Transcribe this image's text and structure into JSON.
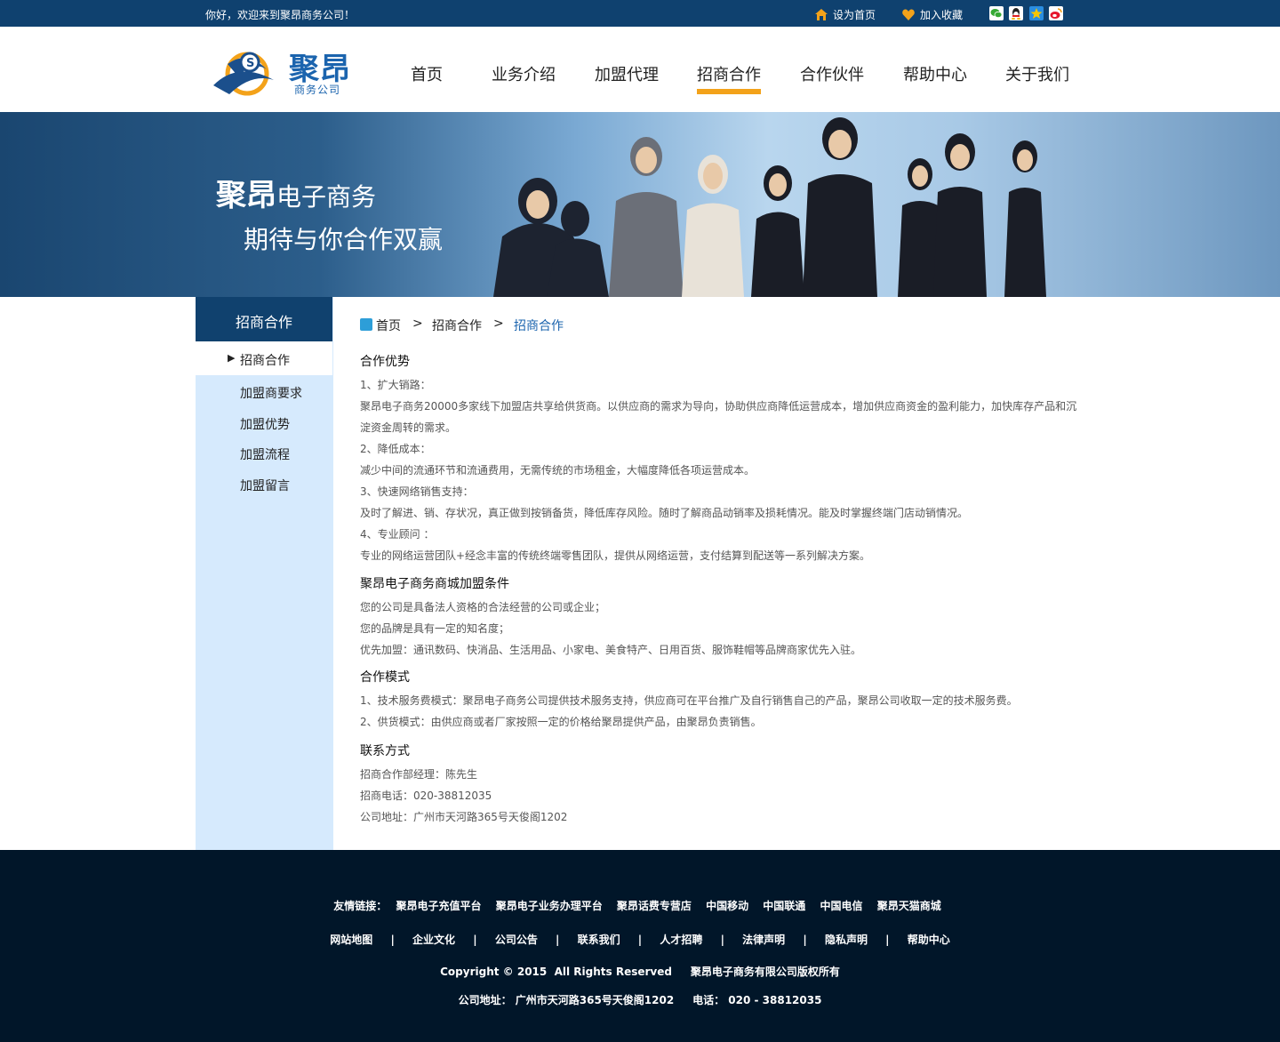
{
  "topbar": {
    "welcome": "你好，欢迎来到聚昂商务公司！",
    "set_home": "设为首页",
    "bookmark": "加入收藏",
    "social_icons": [
      "wechat-icon",
      "qq-icon",
      "qzone-icon",
      "weibo-icon"
    ]
  },
  "logo": {
    "name": "聚昂",
    "sub": "商务公司"
  },
  "nav": {
    "items": [
      "首页",
      "业务介绍",
      "加盟代理",
      "招商合作",
      "合作伙伴",
      "帮助中心",
      "关于我们"
    ],
    "active": "招商合作"
  },
  "banner": {
    "line1_bold": "聚昂",
    "line1_rest": "电子商务",
    "line2": "期待与你合作双赢"
  },
  "sidebar": {
    "title": "招商合作",
    "active_item": "招商合作",
    "items": [
      "加盟商要求",
      "加盟优势",
      "加盟流程",
      "加盟留言"
    ]
  },
  "breadcrumb": {
    "home": "首页",
    "sep": ">",
    "level1": "招商合作",
    "level2": "招商合作"
  },
  "content": {
    "s1_title": "合作优势",
    "s1_l1": "1、扩大销路：",
    "s1_l2": "聚昂电子商务20000多家线下加盟店共享给供货商。以供应商的需求为导向，协助供应商降低运营成本，增加供应商资金的盈利能力，加快库存产品和沉",
    "s1_l3": "淀资金周转的需求。",
    "s1_l4": "2、降低成本：",
    "s1_l5": "减少中间的流通环节和流通费用，无需传统的市场租金，大幅度降低各项运营成本。",
    "s1_l6": "3、快速网络销售支持：",
    "s1_l7": "及时了解进、销、存状况，真正做到按销备货，降低库存风险。随时了解商品动销率及损耗情况。能及时掌握终端门店动销情况。",
    "s1_l8": "4、专业顾问 ：",
    "s1_l9": "专业的网络运营团队+经念丰富的传统终端零售团队，提供从网络运营，支付结算到配送等一系列解决方案。",
    "s2_title": "聚昂电子商务商城加盟条件",
    "s2_l1": "您的公司是具备法人资格的合法经营的公司或企业；",
    "s2_l2": "您的品牌是具有一定的知名度；",
    "s2_l3": "优先加盟：通讯数码、快消品、生活用品、小家电、美食特产、日用百货、服饰鞋帽等品牌商家优先入驻。",
    "s3_title": "合作模式",
    "s3_l1": "1、技术服务费模式：聚昂电子商务公司提供技术服务支持，供应商可在平台推广及自行销售自己的产品，聚昂公司收取一定的技术服务费。",
    "s3_l2": "2、供货模式：由供应商或者厂家按照一定的价格给聚昂提供产品，由聚昂负责销售。",
    "s4_title": "联系方式",
    "s4_l1": "招商合作部经理：陈先生",
    "s4_l2": "招商电话：020-38812035",
    "s4_l3": "公司地址：广州市天河路365号天俊阁1202"
  },
  "footer": {
    "friend_label": "友情链接：",
    "friend_links": [
      "聚昂电子充值平台",
      "聚昂电子业务办理平台",
      "聚昂话费专营店",
      "中国移动",
      "中国联通",
      "中国电信",
      "聚昂天猫商城"
    ],
    "site_links": [
      "网站地图",
      "企业文化",
      "公司公告",
      "联系我们",
      "人才招聘",
      "法律声明",
      "隐私声明",
      "帮助中心"
    ],
    "separator": "|",
    "copyright": "Copyright © 2015  All Rights Reserved     聚昂电子商务有限公司版权所有",
    "address": "公司地址： 广州市天河路365号天俊阁1202     电话： 020 - 38812035"
  },
  "colors": {
    "topbar": "#0f416f",
    "accent": "#f3a21a",
    "sidebar_bg": "#d6eafd",
    "sidebar_head": "#10416e",
    "footer_bg": "#011629",
    "brand_blue": "#1b64ae"
  }
}
